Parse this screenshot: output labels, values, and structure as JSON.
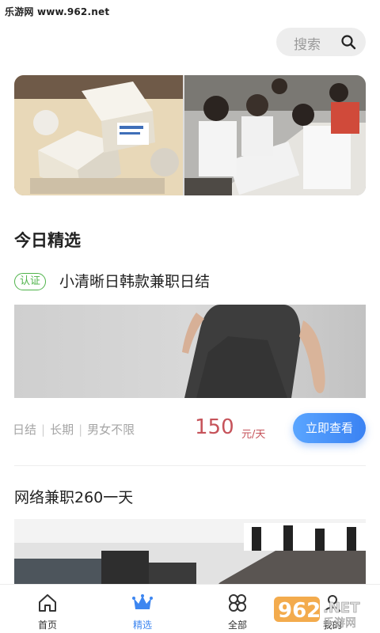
{
  "watermark": {
    "site": "乐游网 www.962.net",
    "logo_text": "962",
    "logo_sub": "乐游网",
    "logo_suffix": ".NET"
  },
  "search": {
    "label": "搜索"
  },
  "section": {
    "title": "今日精选"
  },
  "featured_job": {
    "badge": "认证",
    "title": "小清晰日韩款兼职日结",
    "tags": [
      "日结",
      "长期",
      "男女不限"
    ],
    "price": "150",
    "price_unit": "元/天",
    "cta": "立即查看"
  },
  "second_job": {
    "title": "网络兼职260一天"
  },
  "tabbar": {
    "items": [
      {
        "label": "首页",
        "icon": "home-icon",
        "active": false
      },
      {
        "label": "精选",
        "icon": "crown-icon",
        "active": true
      },
      {
        "label": "全部",
        "icon": "clover-icon",
        "active": false
      },
      {
        "label": "我的",
        "icon": "user-icon",
        "active": false
      }
    ]
  },
  "colors": {
    "accent": "#3d86f0",
    "price": "#c6535a",
    "badge": "#4fb34a"
  }
}
